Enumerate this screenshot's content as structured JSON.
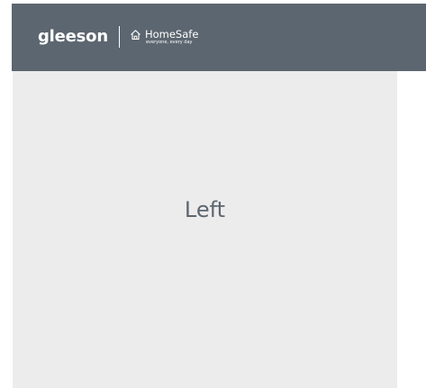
{
  "header": {
    "brand_name": "gleeson",
    "homesafe_name": "HomeSafe",
    "homesafe_tagline": "everyone, every day",
    "icon": "house-icon",
    "background_color": "#5c6670"
  },
  "main": {
    "pane_label": "Left",
    "pane_background_color": "#ececec"
  }
}
